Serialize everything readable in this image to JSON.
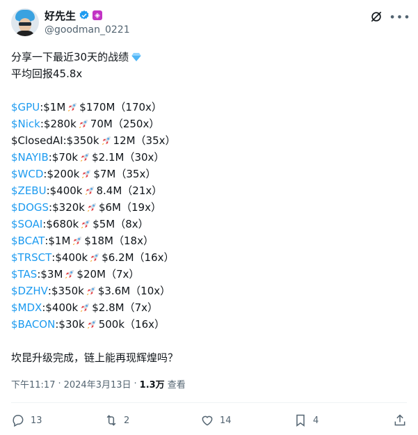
{
  "user": {
    "display_name": "好先生",
    "handle": "@goodman_0221",
    "verified_color": "#1d9bf0",
    "badge_icon": "pink-square-badge"
  },
  "tweet": {
    "intro_line1": "分享一下最近30天的战绩",
    "intro_line2": "平均回报45.8x",
    "holdings": [
      {
        "tag": "$GPU",
        "start": ":$1M",
        "end": "$170M（170x）"
      },
      {
        "tag": "$Nick",
        "start": ":$280k",
        "end": "70M（250x）"
      },
      {
        "tag": "",
        "start": "$ClosedAI:$350k",
        "end": "12M（35x）"
      },
      {
        "tag": "$NAYIB",
        "start": ":$70k",
        "end": "$2.1M（30x）"
      },
      {
        "tag": "$WCD",
        "start": ":$200k",
        "end": "$7M（35x）"
      },
      {
        "tag": "$ZEBU",
        "start": ":$400k",
        "end": "8.4M（21x）"
      },
      {
        "tag": "$DOGS",
        "start": ":$320k",
        "end": "$6M（19x）"
      },
      {
        "tag": "$SOAI",
        "start": ":$680k",
        "end": "$5M（8x）"
      },
      {
        "tag": "$BCAT",
        "start": ":$1M",
        "end": "$18M（18x）"
      },
      {
        "tag": "$TRSCT",
        "start": ":$400k",
        "end": "$6.2M（16x）"
      },
      {
        "tag": "$TAS",
        "start": ":$3M",
        "end": "$20M（7x）"
      },
      {
        "tag": "$DZHV",
        "start": ":$350k",
        "end": "$3.6M（10x）"
      },
      {
        "tag": "$MDX",
        "start": ":$400k",
        "end": "$2.8M（7x）"
      },
      {
        "tag": "$BACON",
        "start": ":$30k",
        "end": "500k（16x）"
      }
    ],
    "closing": "坎昆升级完成，链上能再现辉煌吗？"
  },
  "meta": {
    "time": "下午11:17",
    "separator": "·",
    "date": "2024年3月13日",
    "separator2": "·",
    "views_count": "1.3万",
    "views_label": "查看"
  },
  "actions": {
    "replies": "13",
    "reposts": "2",
    "likes": "14",
    "bookmarks": "4"
  },
  "colors": {
    "accent": "#1d9bf0",
    "muted": "#536471",
    "text": "#0f1419"
  }
}
